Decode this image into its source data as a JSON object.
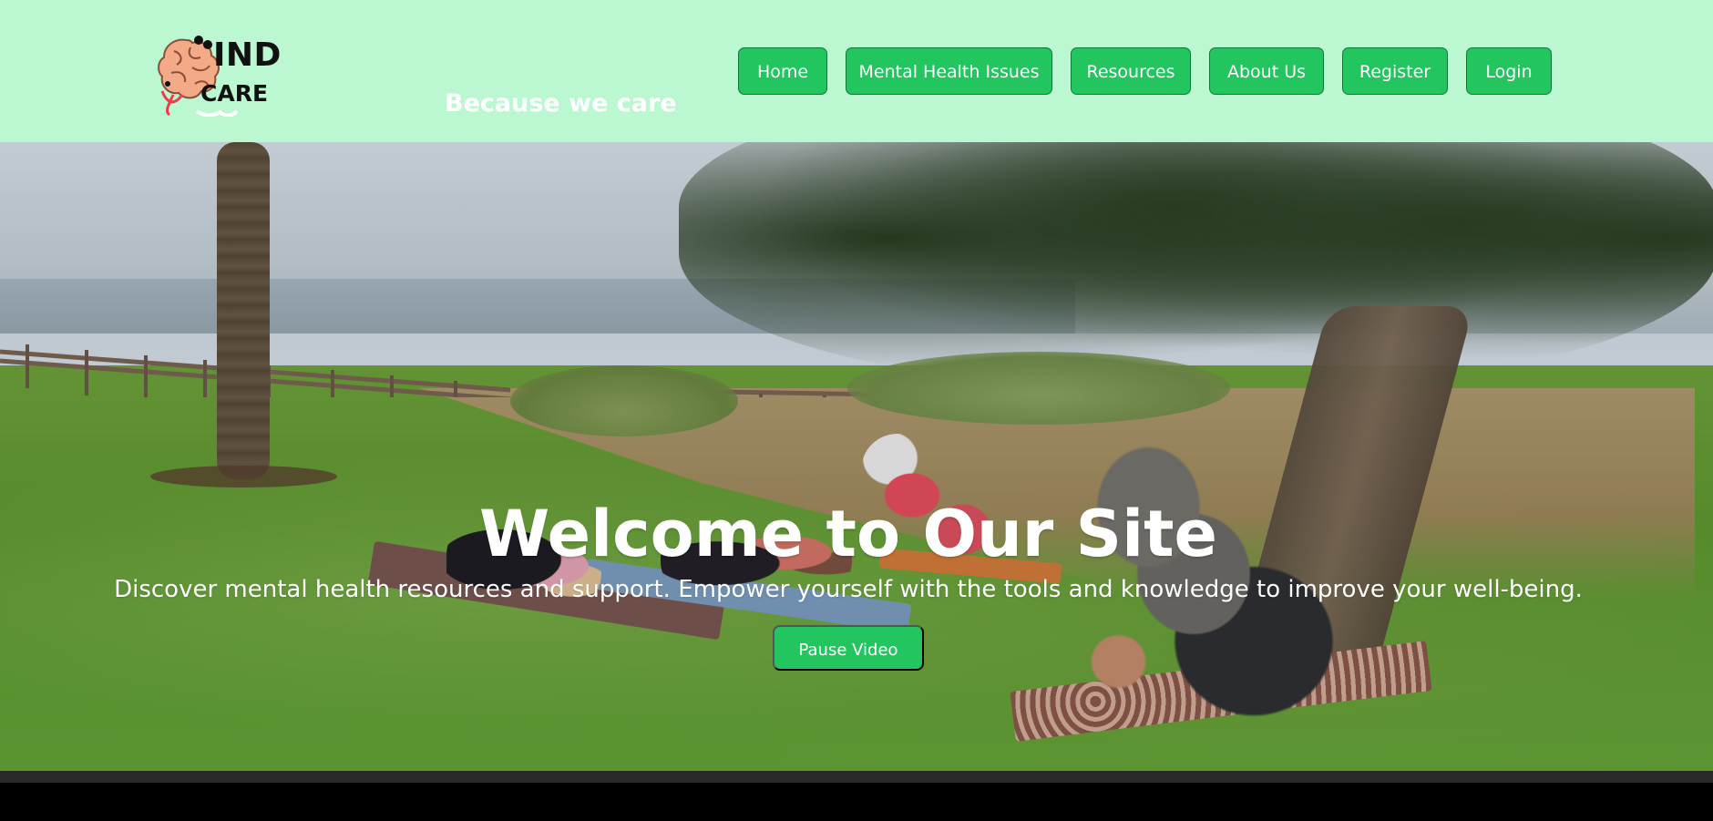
{
  "header": {
    "logo": {
      "main": "IND",
      "sub": "CARE",
      "icon": "brain-icon"
    },
    "tagline": "Because we care",
    "nav": [
      {
        "label": "Home"
      },
      {
        "label": "Mental Health Issues"
      },
      {
        "label": "Resources"
      },
      {
        "label": "About Us"
      },
      {
        "label": "Register"
      },
      {
        "label": "Login"
      }
    ]
  },
  "hero": {
    "title": "Welcome to Our Site",
    "subtitle": "Discover mental health resources and support. Empower yourself with the tools and knowledge to improve your well-being.",
    "button": "Pause Video"
  },
  "theme": {
    "header_background": "#bbf7d0",
    "accent": "#22c55e"
  }
}
